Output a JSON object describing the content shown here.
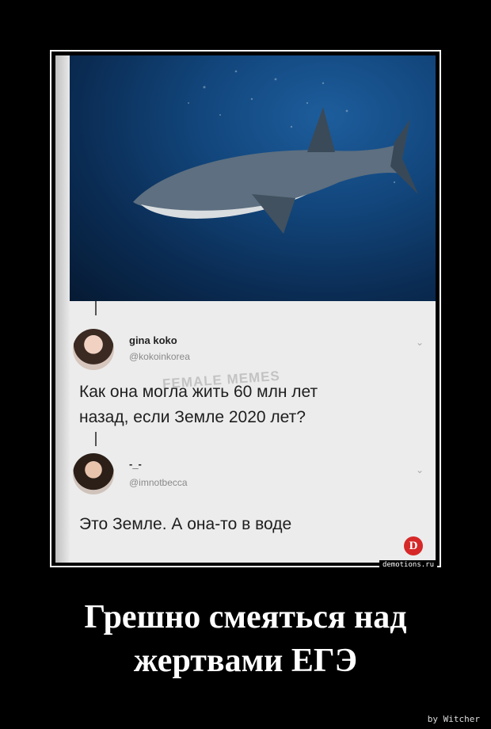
{
  "tweet1": {
    "name": "gina koko",
    "handle": "@kokoinkorea",
    "text_line1": "Как она могла жить 60 млн лет",
    "text_line2": "назад, если Земле 2020 лет?"
  },
  "watermark": "FEMALE MEMES",
  "tweet2": {
    "name": "-_-",
    "handle": "@imnotbecca",
    "text": "Это Земле. А она-то в воде"
  },
  "site_tag": "demotions.ru",
  "badge_letter": "D",
  "caption_line1": "Грешно смеяться над",
  "caption_line2": "жертвами ЕГЭ",
  "credit": "by Witcher",
  "colors": {
    "background": "#000000",
    "ocean": "#12467c",
    "badge": "#d62828"
  }
}
